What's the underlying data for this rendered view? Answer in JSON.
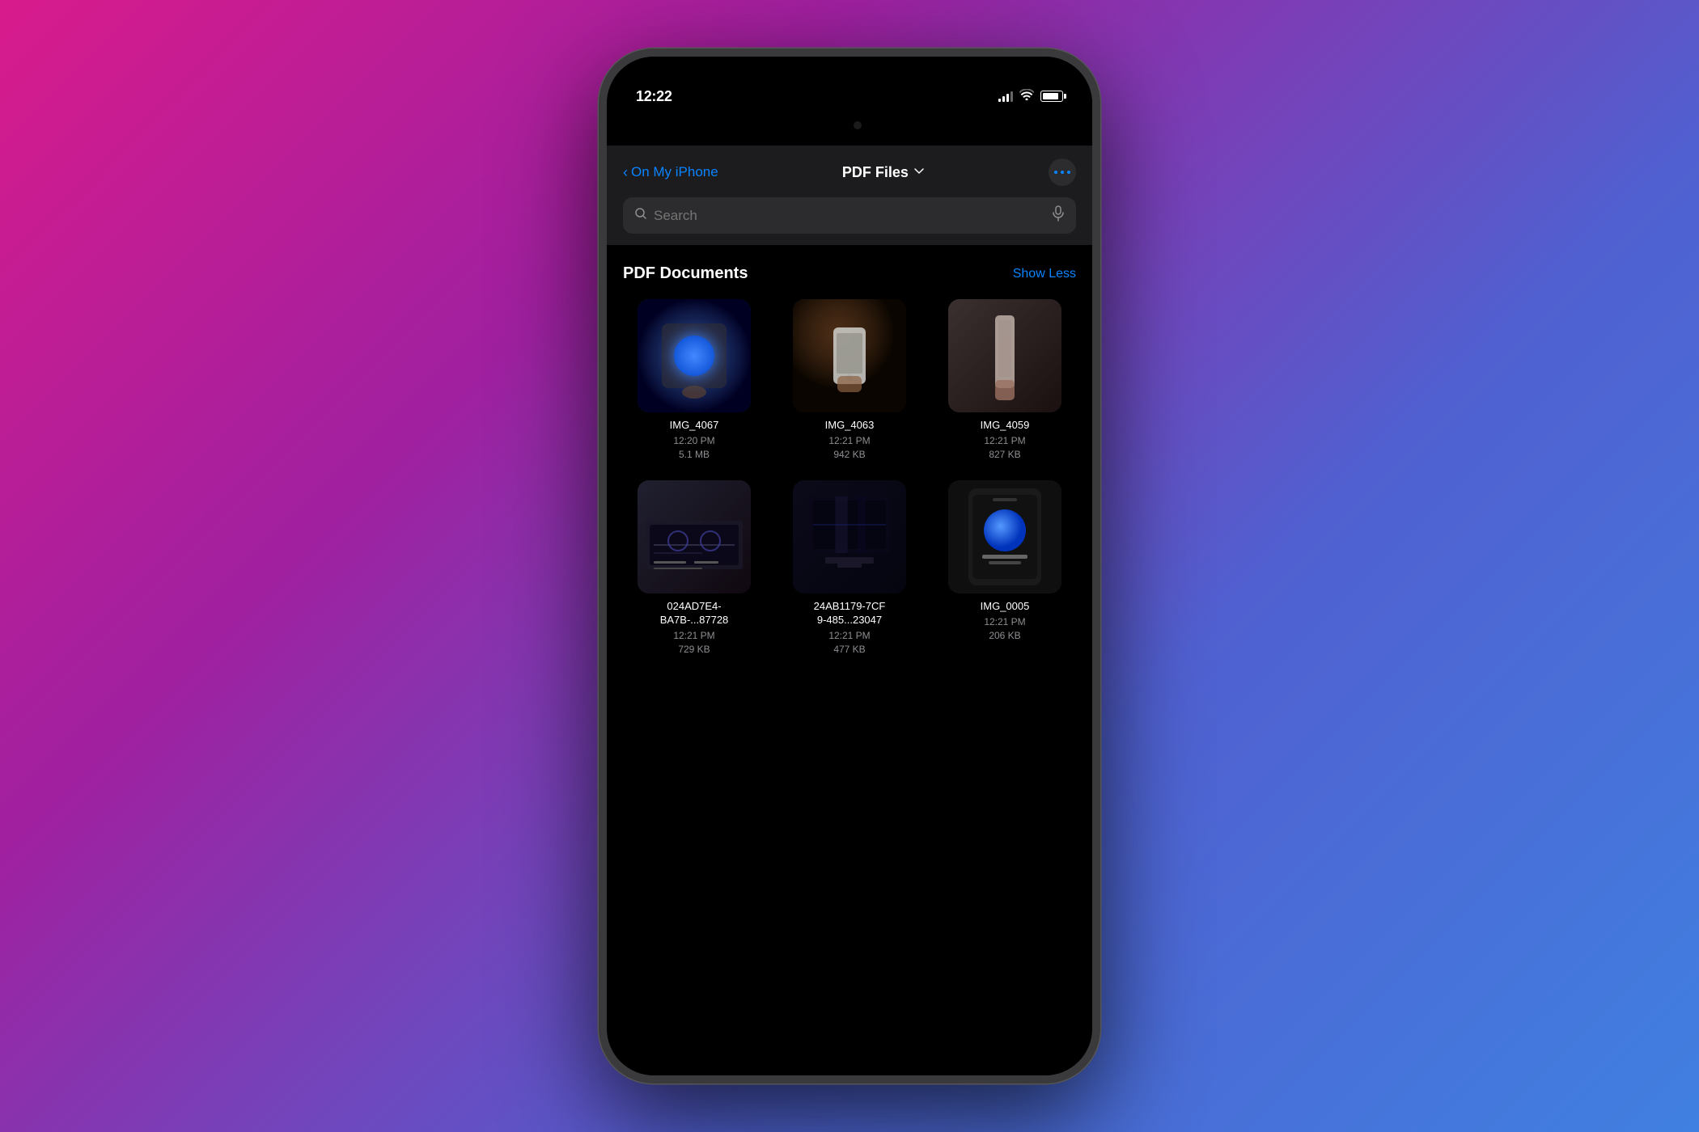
{
  "background": "gradient pink to blue",
  "status_bar": {
    "time": "12:22",
    "signal": "medium",
    "wifi": true,
    "battery": 85
  },
  "navigation": {
    "back_label": "On My iPhone",
    "title": "PDF Files",
    "has_chevron": true,
    "more_button_label": "..."
  },
  "search": {
    "placeholder": "Search"
  },
  "section": {
    "title": "PDF Documents",
    "show_less_label": "Show Less"
  },
  "files": [
    {
      "id": "img-4067",
      "name": "IMG_4067",
      "time": "12:20 PM",
      "size": "5.1 MB",
      "thumb_type": "4067"
    },
    {
      "id": "img-4063",
      "name": "IMG_4063",
      "time": "12:21 PM",
      "size": "942 KB",
      "thumb_type": "4063"
    },
    {
      "id": "img-4059",
      "name": "IMG_4059",
      "time": "12:21 PM",
      "size": "827 KB",
      "thumb_type": "4059"
    },
    {
      "id": "file-024ad",
      "name": "024AD7E4-\nBA7B-...87728",
      "time": "12:21 PM",
      "size": "729 KB",
      "thumb_type": "024ad"
    },
    {
      "id": "file-24ab",
      "name": "24AB1179-7CF\n9-485...23047",
      "time": "12:21 PM",
      "size": "477 KB",
      "thumb_type": "24ab"
    },
    {
      "id": "img-0005",
      "name": "IMG_0005",
      "time": "12:21 PM",
      "size": "206 KB",
      "thumb_type": "0005"
    }
  ]
}
